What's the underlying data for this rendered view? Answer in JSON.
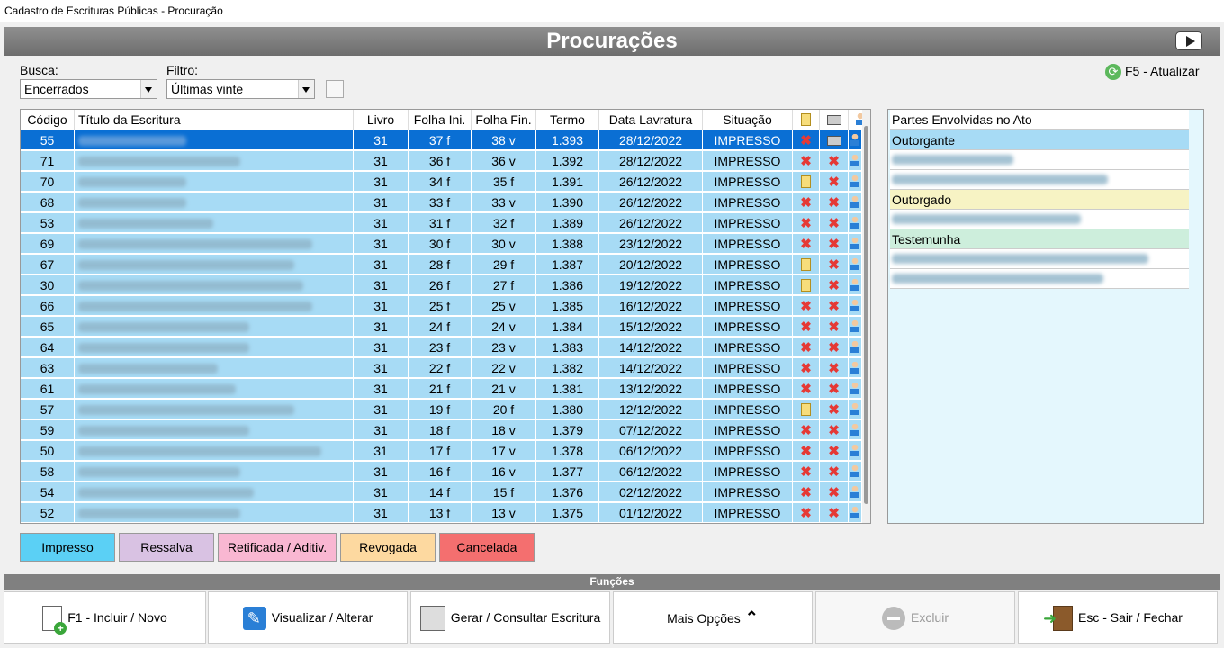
{
  "window": {
    "title": "Cadastro de Escrituras Públicas - Procuração"
  },
  "header": {
    "title": "Procurações",
    "video_icon": "youtube-play-icon"
  },
  "search": {
    "label": "Busca:",
    "value": "Encerrados"
  },
  "filter": {
    "label": "Filtro:",
    "value": "Últimas vinte"
  },
  "refresh": {
    "label": "F5 - Atualizar"
  },
  "grid": {
    "columns": [
      "Código",
      "Título da Escritura",
      "Livro",
      "Folha Ini.",
      "Folha Fin.",
      "Termo",
      "Data Lavratura",
      "Situação"
    ],
    "rows": [
      {
        "codigo": "55",
        "livro": "31",
        "folha_ini": "37 f",
        "folha_fin": "38 v",
        "termo": "1.393",
        "data": "28/12/2022",
        "situacao": "IMPRESSO",
        "c1": "x",
        "c2": "printer",
        "selected": true
      },
      {
        "codigo": "71",
        "livro": "31",
        "folha_ini": "36 f",
        "folha_fin": "36 v",
        "termo": "1.392",
        "data": "28/12/2022",
        "situacao": "IMPRESSO",
        "c1": "x",
        "c2": "x"
      },
      {
        "codigo": "70",
        "livro": "31",
        "folha_ini": "34 f",
        "folha_fin": "35 f",
        "termo": "1.391",
        "data": "26/12/2022",
        "situacao": "IMPRESSO",
        "c1": "doc",
        "c2": "x"
      },
      {
        "codigo": "68",
        "livro": "31",
        "folha_ini": "33 f",
        "folha_fin": "33 v",
        "termo": "1.390",
        "data": "26/12/2022",
        "situacao": "IMPRESSO",
        "c1": "x",
        "c2": "x"
      },
      {
        "codigo": "53",
        "livro": "31",
        "folha_ini": "31 f",
        "folha_fin": "32 f",
        "termo": "1.389",
        "data": "26/12/2022",
        "situacao": "IMPRESSO",
        "c1": "x",
        "c2": "x"
      },
      {
        "codigo": "69",
        "livro": "31",
        "folha_ini": "30 f",
        "folha_fin": "30 v",
        "termo": "1.388",
        "data": "23/12/2022",
        "situacao": "IMPRESSO",
        "c1": "x",
        "c2": "x"
      },
      {
        "codigo": "67",
        "livro": "31",
        "folha_ini": "28 f",
        "folha_fin": "29 f",
        "termo": "1.387",
        "data": "20/12/2022",
        "situacao": "IMPRESSO",
        "c1": "doc",
        "c2": "x"
      },
      {
        "codigo": "30",
        "livro": "31",
        "folha_ini": "26 f",
        "folha_fin": "27 f",
        "termo": "1.386",
        "data": "19/12/2022",
        "situacao": "IMPRESSO",
        "c1": "doc",
        "c2": "x"
      },
      {
        "codigo": "66",
        "livro": "31",
        "folha_ini": "25 f",
        "folha_fin": "25 v",
        "termo": "1.385",
        "data": "16/12/2022",
        "situacao": "IMPRESSO",
        "c1": "x",
        "c2": "x"
      },
      {
        "codigo": "65",
        "livro": "31",
        "folha_ini": "24 f",
        "folha_fin": "24 v",
        "termo": "1.384",
        "data": "15/12/2022",
        "situacao": "IMPRESSO",
        "c1": "x",
        "c2": "x"
      },
      {
        "codigo": "64",
        "livro": "31",
        "folha_ini": "23 f",
        "folha_fin": "23 v",
        "termo": "1.383",
        "data": "14/12/2022",
        "situacao": "IMPRESSO",
        "c1": "x",
        "c2": "x"
      },
      {
        "codigo": "63",
        "livro": "31",
        "folha_ini": "22 f",
        "folha_fin": "22 v",
        "termo": "1.382",
        "data": "14/12/2022",
        "situacao": "IMPRESSO",
        "c1": "x",
        "c2": "x"
      },
      {
        "codigo": "61",
        "livro": "31",
        "folha_ini": "21 f",
        "folha_fin": "21 v",
        "termo": "1.381",
        "data": "13/12/2022",
        "situacao": "IMPRESSO",
        "c1": "x",
        "c2": "x"
      },
      {
        "codigo": "57",
        "livro": "31",
        "folha_ini": "19 f",
        "folha_fin": "20 f",
        "termo": "1.380",
        "data": "12/12/2022",
        "situacao": "IMPRESSO",
        "c1": "doc",
        "c2": "x"
      },
      {
        "codigo": "59",
        "livro": "31",
        "folha_ini": "18 f",
        "folha_fin": "18 v",
        "termo": "1.379",
        "data": "07/12/2022",
        "situacao": "IMPRESSO",
        "c1": "x",
        "c2": "x"
      },
      {
        "codigo": "50",
        "livro": "31",
        "folha_ini": "17 f",
        "folha_fin": "17 v",
        "termo": "1.378",
        "data": "06/12/2022",
        "situacao": "IMPRESSO",
        "c1": "x",
        "c2": "x"
      },
      {
        "codigo": "58",
        "livro": "31",
        "folha_ini": "16 f",
        "folha_fin": "16 v",
        "termo": "1.377",
        "data": "06/12/2022",
        "situacao": "IMPRESSO",
        "c1": "x",
        "c2": "x"
      },
      {
        "codigo": "54",
        "livro": "31",
        "folha_ini": "14 f",
        "folha_fin": "15 f",
        "termo": "1.376",
        "data": "02/12/2022",
        "situacao": "IMPRESSO",
        "c1": "x",
        "c2": "x"
      },
      {
        "codigo": "52",
        "livro": "31",
        "folha_ini": "13 f",
        "folha_fin": "13 v",
        "termo": "1.375",
        "data": "01/12/2022",
        "situacao": "IMPRESSO",
        "c1": "x",
        "c2": "x"
      }
    ]
  },
  "legend": [
    {
      "label": "Impresso",
      "color": "#5bd0f5"
    },
    {
      "label": "Ressalva",
      "color": "#d9c2e3"
    },
    {
      "label": "Retificada / Aditiv.",
      "color": "#f9b7d2"
    },
    {
      "label": "Revogada",
      "color": "#fdd9a0"
    },
    {
      "label": "Cancelada",
      "color": "#f46f6f"
    }
  ],
  "parties": {
    "header": "Partes Envolvidas no Ato",
    "groups": [
      {
        "label": "Outorgante",
        "color": "#a7dbf5",
        "count": 2
      },
      {
        "label": "Outorgado",
        "color": "#f7f3c4",
        "count": 1
      },
      {
        "label": "Testemunha",
        "color": "#cdeedc",
        "count": 2
      }
    ]
  },
  "functions": {
    "title": "Funções",
    "buttons": [
      {
        "label": "F1 - Incluir / Novo",
        "icon": "new-document-icon",
        "enabled": true
      },
      {
        "label": "Visualizar / Alterar",
        "icon": "edit-icon",
        "enabled": true
      },
      {
        "label": "Gerar / Consultar Escritura",
        "icon": "stamp-document-icon",
        "enabled": true
      },
      {
        "label": "Mais Opções",
        "icon": "chevron-up-icon",
        "enabled": true
      },
      {
        "label": "Excluir",
        "icon": "delete-icon",
        "enabled": false
      },
      {
        "label": "Esc - Sair / Fechar",
        "icon": "exit-door-icon",
        "enabled": true
      }
    ]
  }
}
